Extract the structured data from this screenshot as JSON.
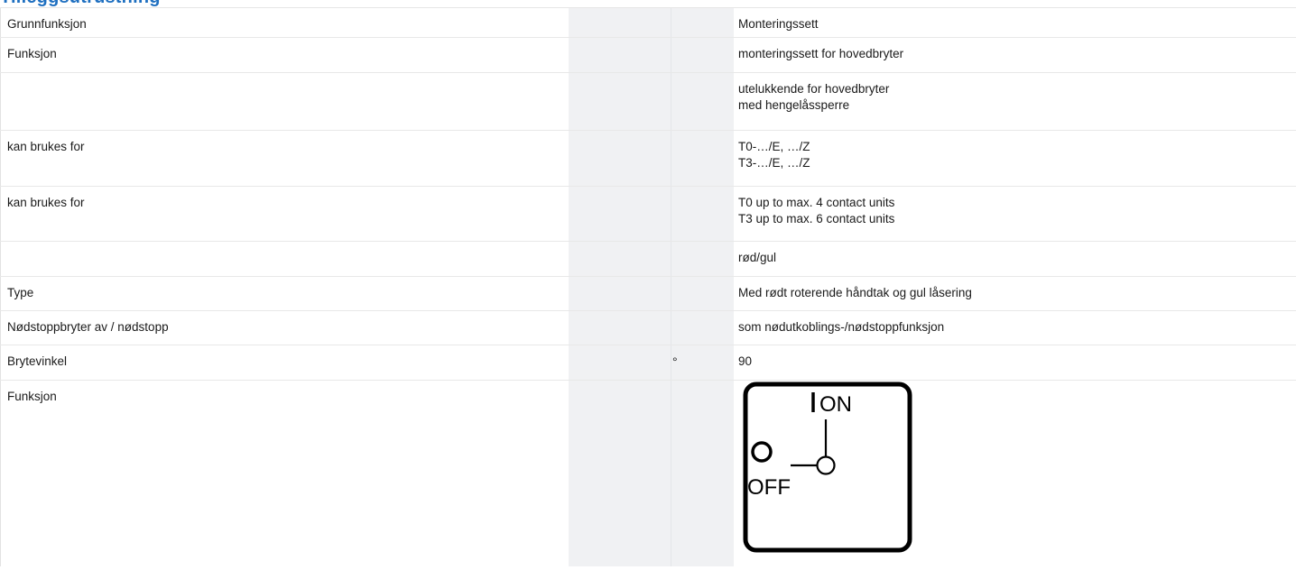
{
  "section": {
    "title": "Tilleggsutrustning"
  },
  "rows": [
    {
      "label": "Grunnfunksjon",
      "unit": "",
      "value": [
        "Monteringssett"
      ]
    },
    {
      "label": "Funksjon",
      "unit": "",
      "value": [
        "monteringssett for hovedbryter"
      ]
    },
    {
      "label": "",
      "unit": "",
      "value": [
        "utelukkende for hovedbryter",
        "med hengelåssperre"
      ]
    },
    {
      "label": "kan brukes for",
      "unit": "",
      "value": [
        "T0-…/E, …/Z",
        "T3-…/E, …/Z"
      ]
    },
    {
      "label": "kan brukes for",
      "unit": "",
      "value": [
        "T0 up to max. 4 contact units",
        "T3 up to max. 6 contact units"
      ]
    },
    {
      "label": "",
      "unit": "",
      "value": [
        "rød/gul"
      ]
    },
    {
      "label": "Type",
      "unit": "",
      "value": [
        "Med rødt roterende håndtak og gul låsering"
      ]
    },
    {
      "label": "Nødstoppbryter av / nødstopp",
      "unit": "",
      "value": [
        "som nødutkoblings-/nødstoppfunksjon"
      ]
    },
    {
      "label": "Brytevinkel",
      "unit": "°",
      "value": [
        "90"
      ]
    },
    {
      "label": "Funksjon",
      "unit": "",
      "value": [],
      "diagram": {
        "on_label": "ON",
        "off_label": "OFF",
        "icon": "switch-position-diagram"
      }
    }
  ]
}
